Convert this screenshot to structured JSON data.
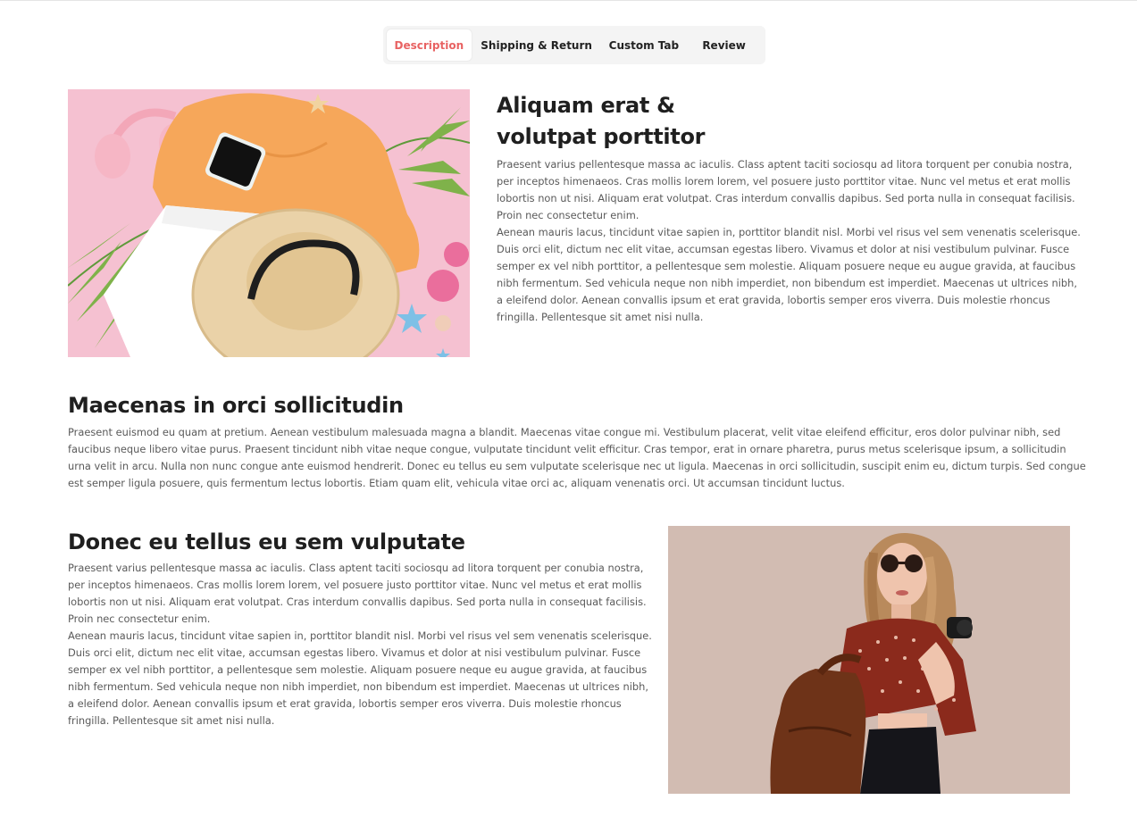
{
  "tabs": [
    {
      "label": "Description",
      "active": true
    },
    {
      "label": "Shipping & Return",
      "active": false
    },
    {
      "label": "Custom Tab",
      "active": false
    },
    {
      "label": "Review",
      "active": false
    }
  ],
  "section1": {
    "title_line1": "Aliquam erat &",
    "title_line2": "volutpat porttitor",
    "paragraph1": "Praesent varius pellentesque massa ac iaculis. Class aptent taciti sociosqu ad litora torquent per conubia nostra, per inceptos himenaeos. Cras mollis lorem lorem, vel posuere justo porttitor vitae. Nunc vel metus et erat mollis lobortis non ut nisi. Aliquam erat volutpat. Cras interdum convallis dapibus. Sed porta nulla in consequat facilisis. Proin nec consectetur enim.",
    "paragraph2": "Aenean mauris lacus, tincidunt vitae sapien in, porttitor blandit nisl. Morbi vel risus vel sem venenatis scelerisque. Duis orci elit, dictum nec elit vitae, accumsan egestas libero. Vivamus et dolor at nisi vestibulum pulvinar. Fusce semper ex vel nibh porttitor, a pellentesque sem molestie. Aliquam posuere neque eu augue gravida, at faucibus nibh fermentum. Sed vehicula neque non nibh imperdiet, non bibendum est imperdiet. Maecenas ut ultrices nibh, a eleifend dolor. Aenean convallis ipsum et erat gravida, lobortis semper eros viverra. Duis molestie rhoncus fringilla. Pellentesque sit amet nisi nulla."
  },
  "section2": {
    "title": "Maecenas in orci sollicitudin",
    "paragraph": "Praesent euismod eu quam at pretium. Aenean vestibulum malesuada magna a blandit. Maecenas vitae congue mi. Vestibulum placerat, velit vitae eleifend efficitur, eros dolor pulvinar nibh, sed faucibus neque libero vitae purus. Praesent tincidunt nibh vitae neque congue, vulputate tincidunt velit efficitur. Cras tempor, erat in ornare pharetra, purus metus scelerisque ipsum, a sollicitudin urna velit in arcu. Nulla non nunc congue ante euismod hendrerit. Donec eu tellus eu sem vulputate scelerisque nec ut ligula. Maecenas in orci sollicitudin, suscipit enim eu, dictum turpis. Sed congue est semper ligula posuere, quis fermentum lectus lobortis. Etiam quam elit, vehicula vitae orci ac, aliquam venenatis orci. Ut accumsan tincidunt luctus."
  },
  "section3": {
    "title": "Donec eu tellus eu sem vulputate",
    "paragraph1": "Praesent varius pellentesque massa ac iaculis. Class aptent taciti sociosqu ad litora torquent per conubia nostra, per inceptos himenaeos. Cras mollis lorem lorem, vel posuere justo porttitor vitae. Nunc vel metus et erat mollis lobortis non ut nisi. Aliquam erat volutpat. Cras interdum convallis dapibus. Sed porta nulla in consequat facilisis. Proin nec consectetur enim.",
    "paragraph2": "Aenean mauris lacus, tincidunt vitae sapien in, porttitor blandit nisl. Morbi vel risus vel sem venenatis scelerisque. Duis orci elit, dictum nec elit vitae, accumsan egestas libero. Vivamus et dolor at nisi vestibulum pulvinar. Fusce semper ex vel nibh porttitor, a pellentesque sem molestie. Aliquam posuere neque eu augue gravida, at faucibus nibh fermentum. Sed vehicula neque non nibh imperdiet, non bibendum est imperdiet. Maecenas ut ultrices nibh, a eleifend dolor. Aenean convallis ipsum et erat gravida, lobortis semper eros viverra. Duis molestie rhoncus fringilla. Pellentesque sit amet nisi nulla."
  },
  "colors": {
    "accent": "#e86262",
    "tab_bar_bg": "#f4f4f4",
    "heading": "#1f1f1f",
    "body_text": "#5a5a5a"
  }
}
